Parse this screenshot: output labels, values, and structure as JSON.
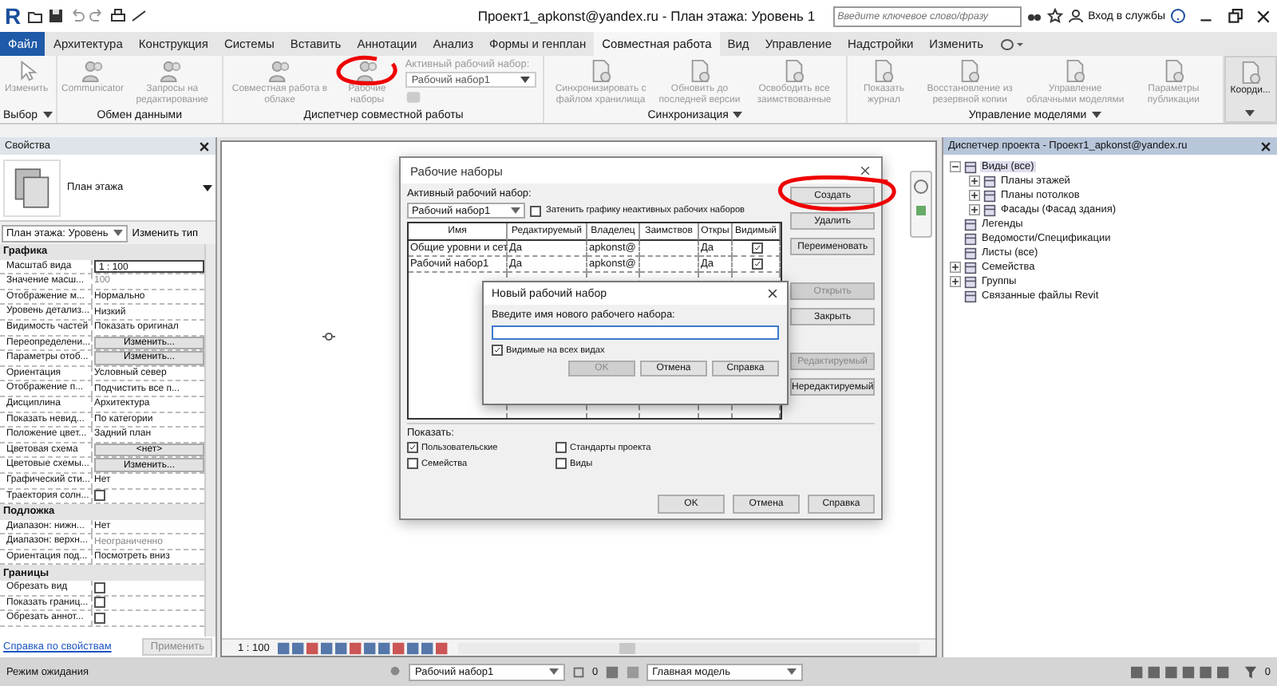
{
  "title_bar": {
    "logo": "R",
    "title": "Проект1_apkonst@yandex.ru - План этажа: Уровень 1",
    "search": {
      "placeholder": "Введите ключевое слово/фразу"
    },
    "sign_in": "Вход в службы"
  },
  "tabs": [
    {
      "label": "Файл",
      "kind": "file",
      "selected": false
    },
    {
      "label": "Архитектура",
      "kind": "tab",
      "selected": false
    },
    {
      "label": "Конструкция",
      "kind": "tab",
      "selected": false
    },
    {
      "label": "Системы",
      "kind": "tab",
      "selected": false
    },
    {
      "label": "Вставить",
      "kind": "tab",
      "selected": false
    },
    {
      "label": "Аннотации",
      "kind": "tab",
      "selected": false
    },
    {
      "label": "Анализ",
      "kind": "tab",
      "selected": false
    },
    {
      "label": "Формы и генплан",
      "kind": "tab",
      "selected": false
    },
    {
      "label": "Совместная работа",
      "kind": "tab",
      "selected": true
    },
    {
      "label": "Вид",
      "kind": "tab",
      "selected": false
    },
    {
      "label": "Управление",
      "kind": "tab",
      "selected": false
    },
    {
      "label": "Надстройки",
      "kind": "tab",
      "selected": false
    },
    {
      "label": "Изменить",
      "kind": "tab",
      "selected": false
    }
  ],
  "ribbon": {
    "panels": [
      {
        "title": "Выбор",
        "dropdown": true,
        "buttons": [
          {
            "label": "Изменить",
            "disabled": true
          }
        ]
      },
      {
        "title": "Обмен данными",
        "dropdown": false,
        "buttons": [
          {
            "label": "Communicator",
            "disabled": true
          },
          {
            "label": "Запросы на редактирование",
            "disabled": true
          }
        ]
      },
      {
        "title": "Диспетчер совместной работы",
        "dropdown": false,
        "buttons": [
          {
            "label": "Совместная работа в облаке",
            "disabled": true
          },
          {
            "label": "Рабочие наборы",
            "disabled": true
          }
        ],
        "active_workset": {
          "label": "Активный рабочий набор:",
          "value": "Рабочий набор1"
        }
      },
      {
        "title": "Синхронизация",
        "dropdown": true,
        "buttons": [
          {
            "label": "Синхронизировать с файлом хранилища",
            "disabled": true
          },
          {
            "label": "Обновить до последней версии",
            "disabled": true
          },
          {
            "label": "Освободить все заимствованные",
            "disabled": true
          }
        ]
      },
      {
        "title": "Управление моделями",
        "dropdown": true,
        "buttons": [
          {
            "label": "Показать журнал",
            "disabled": true
          },
          {
            "label": "Восстановление из резервной копии",
            "disabled": true
          },
          {
            "label": "Управление облачными моделями",
            "disabled": true
          },
          {
            "label": "Параметры публикации",
            "disabled": true
          }
        ]
      },
      {
        "dropdown": true,
        "buttons": [
          {
            "label": "Коорди...",
            "disabled": false
          }
        ]
      }
    ]
  },
  "properties": {
    "title": "Свойства",
    "type_name": "План этажа",
    "instance_selector": "План этажа: Уровень",
    "edit_type": "Изменить тип",
    "groups": [
      {
        "title": "Графика",
        "rows": [
          {
            "name": "Масштаб вида",
            "kind": "input",
            "value": "1 : 100"
          },
          {
            "name": "Значение масш...",
            "kind": "muted",
            "value": "100"
          },
          {
            "name": "Отображение м...",
            "kind": "text",
            "value": "Нормально"
          },
          {
            "name": "Уровень детализ...",
            "kind": "text",
            "value": "Низкий"
          },
          {
            "name": "Видимость частей",
            "kind": "text",
            "value": "Показать оригинал"
          },
          {
            "name": "Переопределени...",
            "kind": "button",
            "value": "Изменить..."
          },
          {
            "name": "Параметры отоб...",
            "kind": "button",
            "value": "Изменить..."
          },
          {
            "name": "Ориентация",
            "kind": "text",
            "value": "Условный север"
          },
          {
            "name": "Отображение п...",
            "kind": "text",
            "value": "Подчистить все п..."
          },
          {
            "name": "Дисциплина",
            "kind": "text",
            "value": "Архитектура"
          },
          {
            "name": "Показать невид...",
            "kind": "text",
            "value": "По категории"
          },
          {
            "name": "Положение цвет...",
            "kind": "text",
            "value": "Задний план"
          },
          {
            "name": "Цветовая схема",
            "kind": "button",
            "value": "<нет>"
          },
          {
            "name": "Цветовые схемы...",
            "kind": "button",
            "value": "Изменить..."
          },
          {
            "name": "Графический сти...",
            "kind": "text",
            "value": "Нет"
          },
          {
            "name": "Траектория солн...",
            "kind": "checkbox",
            "checked": false
          }
        ]
      },
      {
        "title": "Подложка",
        "rows": [
          {
            "name": "Диапазон: нижн...",
            "kind": "text",
            "value": "Нет"
          },
          {
            "name": "Диапазон: верхн...",
            "kind": "muted",
            "value": "Неограниченно"
          },
          {
            "name": "Ориентация под...",
            "kind": "text",
            "value": "Посмотреть вниз"
          }
        ]
      },
      {
        "title": "Границы",
        "rows": [
          {
            "name": "Обрезать вид",
            "kind": "checkbox",
            "checked": false
          },
          {
            "name": "Показать границ...",
            "kind": "checkbox",
            "checked": false
          },
          {
            "name": "Обрезать аннот...",
            "kind": "checkbox",
            "checked": false
          }
        ]
      }
    ],
    "help_link": "Справка по свойствам",
    "apply": "Применить"
  },
  "view_bar": {
    "scale": "1 : 100"
  },
  "worksets_dialog": {
    "title": "Рабочие наборы",
    "active_label": "Активный рабочий набор:",
    "active_value": "Рабочий набор1",
    "gray_inactive": {
      "label": "Затенить графику неактивных рабочих наборов",
      "checked": false
    },
    "columns": [
      "Имя",
      "Редактируемый",
      "Владелец",
      "Заимствов",
      "Откры",
      "Видимый"
    ],
    "rows": [
      {
        "name": "Общие уровни и сет",
        "editable": "Да",
        "owner": "apkonst@",
        "opened": "Да",
        "visible": true
      },
      {
        "name": "Рабочий набор1",
        "editable": "Да",
        "owner": "apkonst@",
        "opened": "Да",
        "visible": true
      }
    ],
    "side_buttons": [
      {
        "label": "Создать",
        "disabled": false
      },
      {
        "label": "Удалить",
        "disabled": false
      },
      {
        "label": "Переименовать",
        "disabled": false
      },
      {
        "label": "Открыть",
        "disabled": true
      },
      {
        "label": "Закрыть",
        "disabled": false
      },
      {
        "label": "Редактируемый",
        "disabled": true
      },
      {
        "label": "Нередактируемый",
        "disabled": false
      }
    ],
    "show_label": "Показать:",
    "show_options": [
      {
        "label": "Пользовательские",
        "checked": true
      },
      {
        "label": "Стандарты проекта",
        "checked": false
      },
      {
        "label": "Семейства",
        "checked": false
      },
      {
        "label": "Виды",
        "checked": false
      }
    ],
    "buttons": [
      {
        "label": "OK",
        "disabled": false
      },
      {
        "label": "Отмена",
        "disabled": false
      },
      {
        "label": "Справка",
        "disabled": false
      }
    ]
  },
  "new_workset_dialog": {
    "title": "Новый рабочий набор",
    "prompt": "Введите имя нового рабочего набора:",
    "visible_all": {
      "label": "Видимые на всех видах",
      "checked": true
    },
    "buttons": [
      {
        "label": "OK",
        "disabled": true
      },
      {
        "label": "Отмена",
        "disabled": false
      },
      {
        "label": "Справка",
        "disabled": false
      }
    ]
  },
  "browser": {
    "title": "Диспетчер проекта - Проект1_apkonst@yandex.ru",
    "tree": [
      {
        "label": "Виды (все)",
        "kind": "folder",
        "expanded": true,
        "selected": true,
        "children": [
          {
            "label": "Планы этажей",
            "kind": "folder",
            "expanded": false,
            "selected": false
          },
          {
            "label": "Планы потолков",
            "kind": "folder",
            "expanded": false,
            "selected": false
          },
          {
            "label": "Фасады (Фасад здания)",
            "kind": "folder",
            "expanded": false,
            "selected": false
          }
        ]
      },
      {
        "label": "Легенды",
        "kind": "leaf",
        "selected": false
      },
      {
        "label": "Ведомости/Спецификации",
        "kind": "leaf",
        "selected": false
      },
      {
        "label": "Листы (все)",
        "kind": "leaf",
        "selected": false
      },
      {
        "label": "Семейства",
        "kind": "folder",
        "expanded": false,
        "selected": false
      },
      {
        "label": "Группы",
        "kind": "folder",
        "expanded": false,
        "selected": false
      },
      {
        "label": "Связанные файлы Revit",
        "kind": "leaf",
        "selected": false
      }
    ]
  },
  "status_bar": {
    "status": "Режим ожидания",
    "workset": "Рабочий набор1",
    "editable_count": "0",
    "model": "Главная модель",
    "filter_count": "0"
  }
}
